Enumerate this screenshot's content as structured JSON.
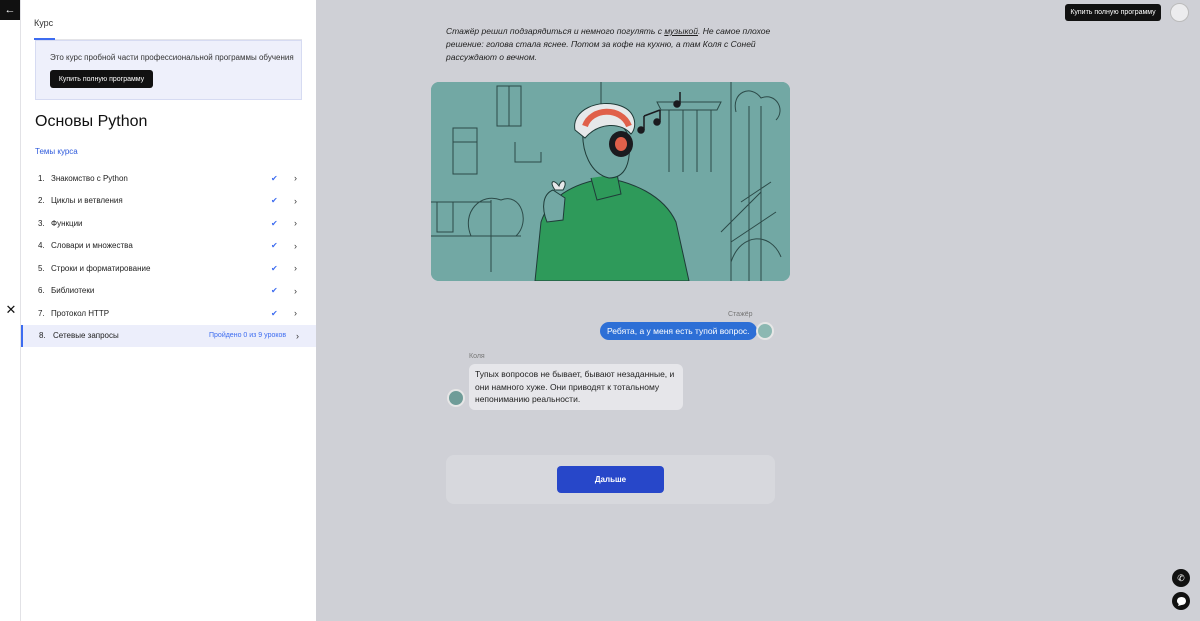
{
  "nav": {
    "back_icon": "arrow-left-icon",
    "close_icon": "close-icon"
  },
  "sidebar": {
    "tab_label": "Курс",
    "promo": {
      "text": "Это курс пробной части профессиональной программы обучения",
      "button": "Купить полную программу"
    },
    "course_title": "Основы Python",
    "topics_link": "Темы курса",
    "topics": [
      {
        "num": "1.",
        "label": "Знакомство с Python",
        "done": true
      },
      {
        "num": "2.",
        "label": "Циклы и ветвления",
        "done": true
      },
      {
        "num": "3.",
        "label": "Функции",
        "done": true
      },
      {
        "num": "4.",
        "label": "Словари и множества",
        "done": true
      },
      {
        "num": "5.",
        "label": "Строки и форматирование",
        "done": true
      },
      {
        "num": "6.",
        "label": "Библиотеки",
        "done": true
      },
      {
        "num": "7.",
        "label": "Протокол HTTP",
        "done": true
      },
      {
        "num": "8.",
        "label": "Сетевые запросы",
        "done": false,
        "progress": "Пройдено 0 из 9 уроков"
      }
    ]
  },
  "main": {
    "story": {
      "before": "Стажёр решил подзарядиться и немного погулять с ",
      "link": "музыкой",
      "after": ". Не самое плохое решение: голова стала яснее. Потом за кофе на кухню, а там Коля с Соней рассуждают о вечном."
    },
    "chat": [
      {
        "author": "Стажёр",
        "text": "Ребята, а у меня есть тупой вопрос."
      },
      {
        "author": "Коля",
        "text": "Тупых вопросов не бывает, бывают незаданные, и они намного хуже. Они приводят к тотальному непониманию реальности."
      }
    ],
    "next_button": "Дальше"
  },
  "header": {
    "buy_button": "Купить полную программу"
  },
  "fabs": {
    "phone_icon": "phone-icon",
    "chat_icon": "chat-icon"
  },
  "colors": {
    "accent": "#3d6cf0",
    "primary_button": "#2747c9",
    "illustration_bg": "#72a8a4",
    "sweater": "#2e9a5a",
    "headphones": "#e0604a"
  }
}
